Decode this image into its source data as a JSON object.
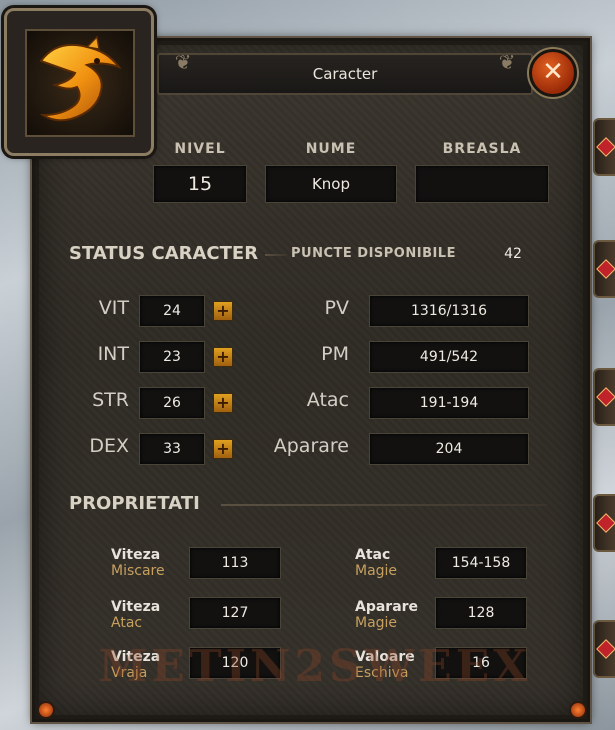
{
  "window": {
    "title": "Caracter",
    "close_label": "✕"
  },
  "header": {
    "level_label": "NIVEL",
    "level_value": "15",
    "name_label": "NUME",
    "name_value": "Knop",
    "guild_label": "BREASLA",
    "guild_value": ""
  },
  "status": {
    "title": "STATUS CARACTER",
    "points_label": "PUNCTE DISPONIBILE",
    "points_value": "42",
    "plus_label": "+",
    "stats": [
      {
        "label": "VIT",
        "value": "24"
      },
      {
        "label": "INT",
        "value": "23"
      },
      {
        "label": "STR",
        "value": "26"
      },
      {
        "label": "DEX",
        "value": "33"
      }
    ],
    "derived": [
      {
        "label": "PV",
        "value": "1316/1316"
      },
      {
        "label": "PM",
        "value": "491/542"
      },
      {
        "label": "Atac",
        "value": "191-194"
      },
      {
        "label": "Aparare",
        "value": "204"
      }
    ]
  },
  "properties": {
    "title": "PROPRIETATI",
    "left": [
      {
        "line1": "Viteza",
        "line2": "Miscare",
        "value": "113"
      },
      {
        "line1": "Viteza",
        "line2": "Atac",
        "value": "127"
      },
      {
        "line1": "Viteza",
        "line2": "Vraja",
        "value": "120"
      }
    ],
    "right": [
      {
        "line1": "Atac",
        "line2": "Magie",
        "value": "154-158"
      },
      {
        "line1": "Aparare",
        "line2": "Magie",
        "value": "128"
      },
      {
        "line1": "Valoare",
        "line2": "Eschiva",
        "value": "16"
      }
    ]
  },
  "watermark": "METIN2SWEEX",
  "colors": {
    "panel": "#2f2b25",
    "accent_orange": "#e0a020",
    "label_gold": "#c7a060",
    "close_red": "#c0401a"
  },
  "icons": {
    "emblem": "dragon-emblem-icon",
    "close": "close-icon",
    "plus": "plus-icon"
  }
}
